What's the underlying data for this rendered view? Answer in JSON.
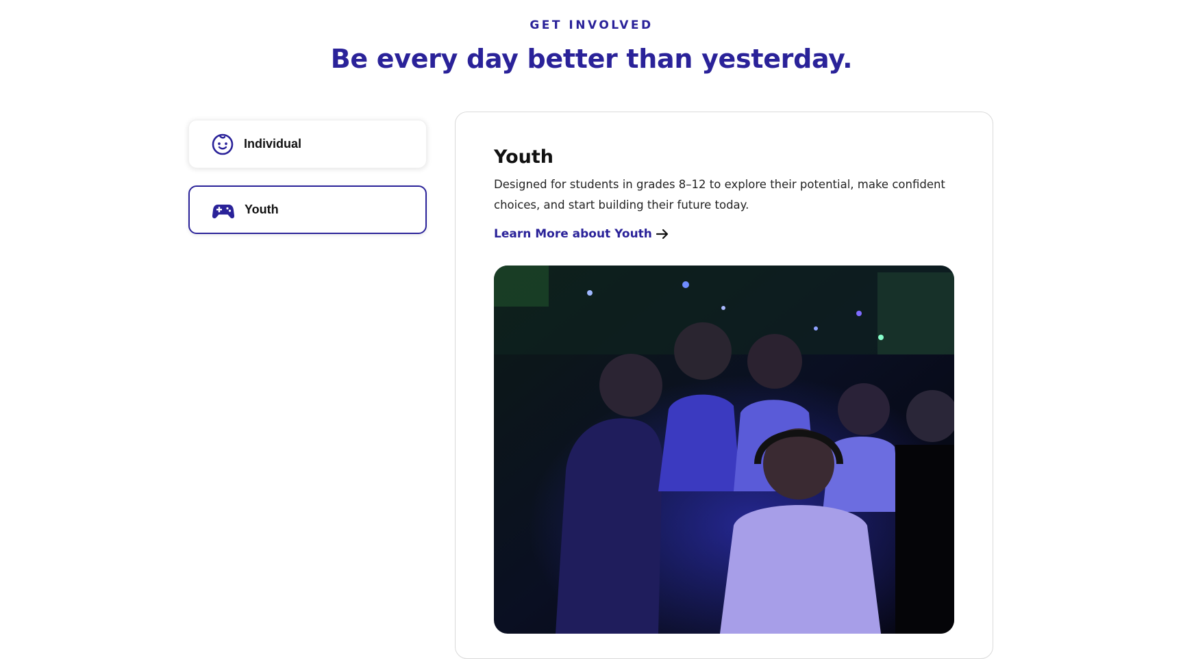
{
  "section": {
    "eyebrow": "GET INVOLVED",
    "headline": "Be every day better than yesterday."
  },
  "tabs": [
    {
      "label": "Individual",
      "icon": "baby-face-icon",
      "active": false
    },
    {
      "label": "Youth",
      "icon": "gamepad-icon",
      "active": true
    }
  ],
  "detail": {
    "title": "Youth",
    "description": "Designed for students in grades 8–12 to explore their potential, make confident choices, and start building their future today.",
    "link_label": "Learn More about Youth",
    "link_icon": "arrow-right-icon",
    "image_icon": "youth-gaming-photo"
  },
  "colors": {
    "accent": "#2a2299",
    "text": "#111111",
    "card_border": "#d9d9d9"
  }
}
